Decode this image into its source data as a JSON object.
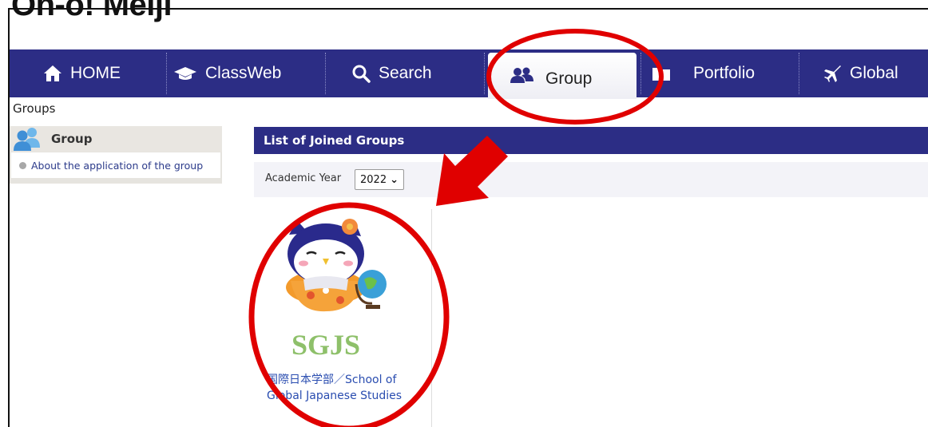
{
  "app": {
    "logo": "Oh-o! Meiji"
  },
  "nav": {
    "items": [
      {
        "label": "HOME",
        "icon": "home-icon"
      },
      {
        "label": "ClassWeb",
        "icon": "graduation-cap-icon"
      },
      {
        "label": "Search",
        "icon": "search-icon"
      },
      {
        "label": "Group",
        "icon": "users-icon",
        "active": true
      },
      {
        "label": "Portfolio",
        "icon": "folder-icon"
      },
      {
        "label": "Global",
        "icon": "airplane-icon"
      }
    ]
  },
  "breadcrumb": "Groups",
  "sidebar": {
    "title": "Group",
    "links": [
      {
        "label": "About the application of the group"
      }
    ]
  },
  "main": {
    "title": "List of Joined Groups",
    "filter": {
      "label": "Academic Year",
      "selected": "2022"
    },
    "groups": [
      {
        "logo_text": "SGJS",
        "name": "国際日本学部／School of Global Japanese Studies"
      }
    ]
  },
  "colors": {
    "nav_bg": "#2c2d85",
    "annotation": "#e00000",
    "sgjs_green": "#8ec06a"
  }
}
